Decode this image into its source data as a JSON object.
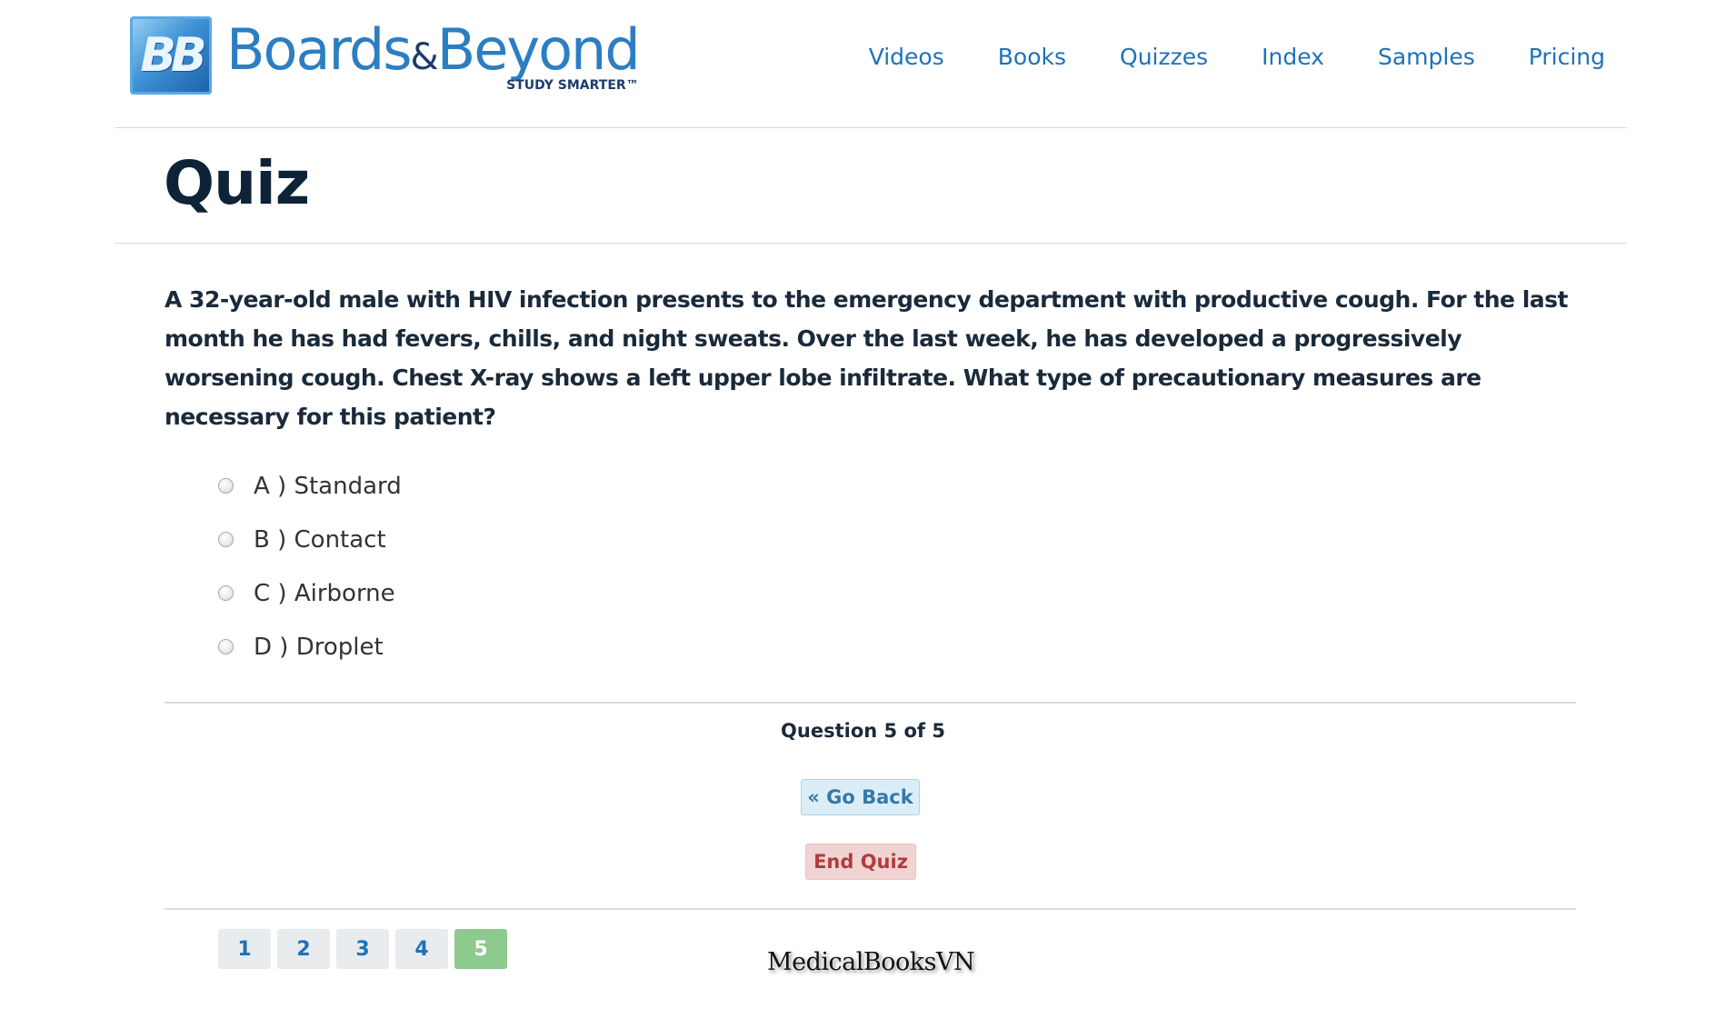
{
  "header": {
    "logo_text": "Boards&Beyond",
    "logo_word_1": "Boards",
    "logo_amp": "&",
    "logo_word_2": "Beyond",
    "logo_tagline": "STUDY SMARTER™",
    "logo_mark": "BB",
    "nav": [
      "Videos",
      "Books",
      "Quizzes",
      "Index",
      "Samples",
      "Pricing"
    ]
  },
  "page": {
    "title": "Quiz"
  },
  "quiz": {
    "question": "A 32-year-old male with HIV infection presents to the emergency department with productive cough. For the last month he has had fevers, chills, and night sweats. Over the last week, he has developed a progressively worsening cough. Chest X-ray shows a left upper lobe infiltrate. What type of precautionary measures are necessary for this patient?",
    "options": [
      "A ) Standard",
      "B ) Contact",
      "C ) Airborne",
      "D ) Droplet"
    ],
    "counter": "Question 5 of 5",
    "go_back_label": "« Go Back",
    "end_quiz_label": "End Quiz",
    "pages": [
      "1",
      "2",
      "3",
      "4",
      "5"
    ],
    "current_page": "5"
  },
  "watermark": "MedicalBooksVN",
  "colors": {
    "nav_link": "#1f72b8",
    "title": "#0e2336",
    "go_back_bg": "#dbeef7",
    "end_quiz_bg": "#f0d3d3",
    "end_quiz_text": "#b23b3b",
    "active_page_bg": "#8ec98e"
  }
}
